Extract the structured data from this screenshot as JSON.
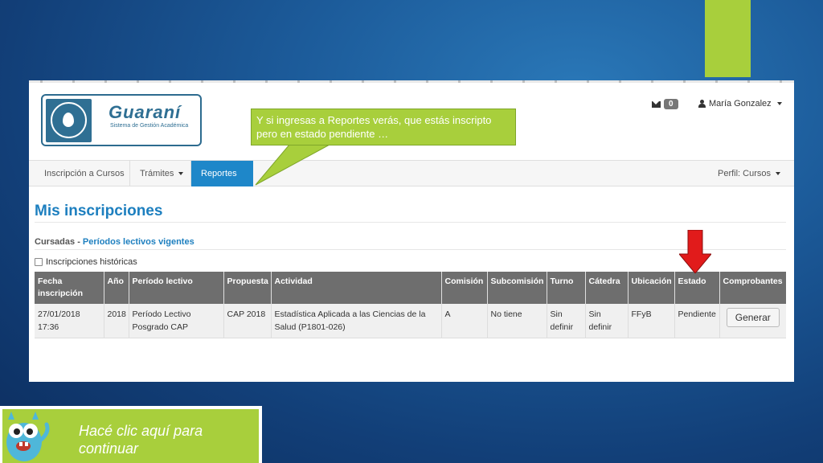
{
  "slide": {
    "callout_text": "Y si ingresas a Reportes verás, que estás inscripto pero en estado pendiente …",
    "bottom_text": "Hacé clic aquí para continuar",
    "accent_green": "#a8cf3c",
    "arrow_color": "#e11b1b"
  },
  "app": {
    "logo_title": "Guaraní",
    "logo_subtitle": "Sistema de Gestión Académica",
    "mail_count": "0",
    "user_name": "María Gonzalez"
  },
  "nav": {
    "items": [
      {
        "label": "Inscripción a Cursos"
      },
      {
        "label": "Trámites"
      },
      {
        "label": "Reportes"
      }
    ],
    "profile": "Perfil: Cursos"
  },
  "page": {
    "title": "Mis inscripciones",
    "section_prefix": "Cursadas - ",
    "section_link": "Períodos lectivos vigentes",
    "historic_checkbox_label": "Inscripciones históricas"
  },
  "table": {
    "headers": [
      "Fecha inscripción",
      "Año",
      "Período lectivo",
      "Propuesta",
      "Actividad",
      "Comisión",
      "Subcomisión",
      "Turno",
      "Cátedra",
      "Ubicación",
      "Estado",
      "Comprobantes"
    ],
    "rows": [
      {
        "fecha": "27/01/2018 17:36",
        "anio": "2018",
        "periodo": "Período Lectivo Posgrado CAP",
        "propuesta": "CAP 2018",
        "actividad": "Estadística Aplicada a las Ciencias de la Salud (P1801-026)",
        "comision": "A",
        "subcomision": "No tiene",
        "turno": "Sin definir",
        "catedra": "Sin definir",
        "ubicacion": "FFyB",
        "estado": "Pendiente",
        "comprobante_button": "Generar"
      }
    ]
  }
}
